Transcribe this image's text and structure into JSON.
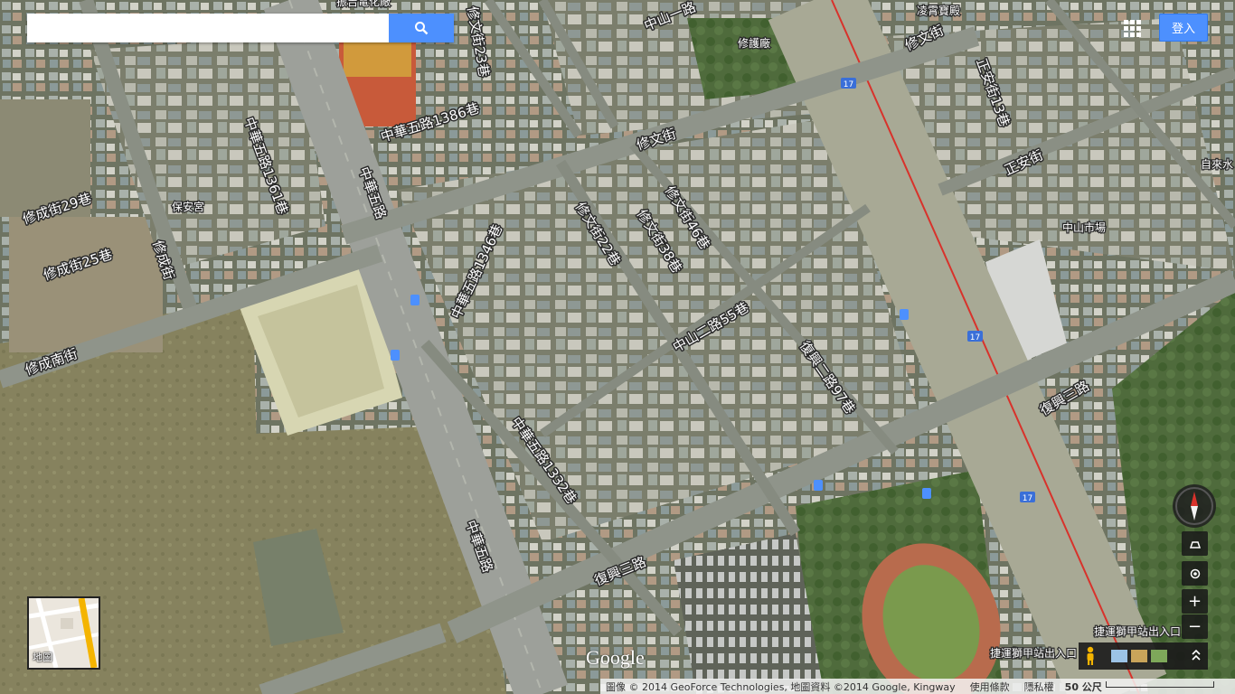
{
  "search": {
    "placeholder": "",
    "value": ""
  },
  "header": {
    "signin_label": "登入"
  },
  "icons": {
    "search": "search-icon",
    "apps": "apps-grid-icon",
    "compass": "compass-icon",
    "tilt": "tilt-icon",
    "locate": "my-location-icon",
    "zoom_in": "zoom-in-icon",
    "zoom_out": "zoom-out-icon",
    "pegman": "pegman-icon",
    "expand": "chevron-up-icon"
  },
  "controls": {
    "zoom_in_label": "+",
    "zoom_out_label": "−"
  },
  "minimap": {
    "label": "地圖"
  },
  "logo": {
    "text": "Google"
  },
  "footer": {
    "imagery_credit": "圖像 © 2014 GeoForce Technologies, 地圖資料 ©2014 Google, Kingway",
    "terms_label": "使用條款",
    "privacy_label": "隱私權",
    "scale_label": "50 公尺"
  },
  "map": {
    "streets": [
      "修文街23巷",
      "中山一路",
      "修護廠",
      "凌霄寶殿",
      "修文街",
      "正安街13巷",
      "中華五路1386巷",
      "修文街",
      "正安街",
      "中華五路1361巷",
      "中華五路",
      "修成街29巷",
      "保安宮",
      "修成街",
      "修成街25巷",
      "修文街46巷",
      "修文街22巷",
      "修文街38巷",
      "中華五路1346巷",
      "中山市場",
      "自來水",
      "中山二路55巷",
      "復興二路97巷",
      "修成南街",
      "復興三路",
      "中華五路1332巷",
      "中華五路",
      "復興三路",
      "捷運獅甲站出入口",
      "捷運獅甲站出入口",
      "振吉電化廠"
    ],
    "highway_shields": [
      "17",
      "17",
      "17"
    ]
  },
  "colors": {
    "accent": "#4d90fe",
    "highway_line": "#d8322b",
    "shield": "#3a6fd8"
  }
}
